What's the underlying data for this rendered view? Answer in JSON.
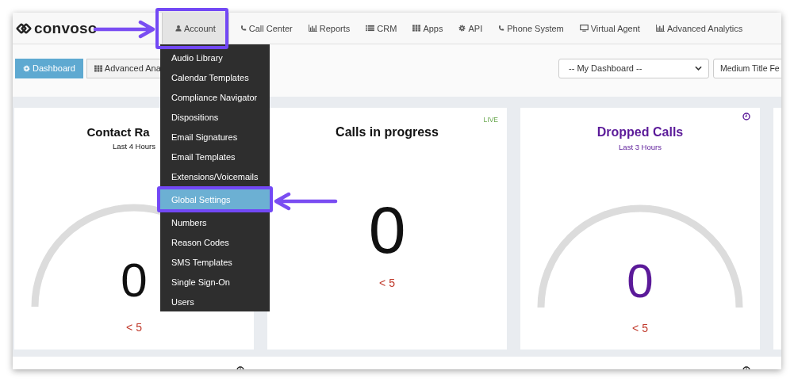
{
  "logo": {
    "text": "convoso"
  },
  "nav": [
    {
      "label": "Account",
      "selected": true
    },
    {
      "label": "Call Center",
      "selected": false
    },
    {
      "label": "Reports",
      "selected": false
    },
    {
      "label": "CRM",
      "selected": false
    },
    {
      "label": "Apps",
      "selected": false
    },
    {
      "label": "API",
      "selected": false
    },
    {
      "label": "Phone System",
      "selected": false
    },
    {
      "label": "Virtual Agent",
      "selected": false
    },
    {
      "label": "Advanced Analytics",
      "selected": false
    }
  ],
  "toolbar": {
    "tabs": [
      {
        "label": "Dashboard",
        "selected": true
      },
      {
        "label": "Advanced Ana",
        "selected": false
      }
    ],
    "dashboard_select": {
      "value": "-- My Dashboard --"
    },
    "title_select": {
      "value": "Medium Title Fe"
    }
  },
  "account_menu": [
    {
      "label": "Audio Library",
      "selected": false
    },
    {
      "label": "Calendar Templates",
      "selected": false
    },
    {
      "label": "Compliance Navigator",
      "selected": false
    },
    {
      "label": "Dispositions",
      "selected": false
    },
    {
      "label": "Email Signatures",
      "selected": false
    },
    {
      "label": "Email Templates",
      "selected": false
    },
    {
      "label": "Extensions/Voicemails",
      "selected": false
    },
    {
      "label": "Global Settings",
      "selected": true
    },
    {
      "label": "Numbers",
      "selected": false
    },
    {
      "label": "Reason Codes",
      "selected": false
    },
    {
      "label": "SMS Templates",
      "selected": false
    },
    {
      "label": "Single Sign-On",
      "selected": false
    },
    {
      "label": "Users",
      "selected": false
    }
  ],
  "cards": [
    {
      "kind": "gauge",
      "title": "Contact Ra",
      "subtitle": "Last 4 Hours",
      "color": "#111111",
      "value": "0",
      "threshold": "< 5"
    },
    {
      "kind": "number",
      "title": "Calls in progress",
      "badge": "LIVE",
      "color": "#111111",
      "value": "0",
      "threshold": "< 5"
    },
    {
      "kind": "gauge",
      "title": "Dropped Calls",
      "subtitle": "Last 3 Hours",
      "color": "#5b1a99",
      "value": "0",
      "threshold": "< 5"
    }
  ]
}
